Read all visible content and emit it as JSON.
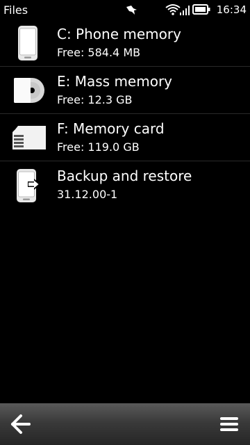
{
  "status_bar": {
    "app_title": "Files",
    "clock": "16:34",
    "icons": [
      "notification-bird-icon",
      "wifi-icon",
      "signal-strength-icon",
      "battery-icon"
    ]
  },
  "storage_list": [
    {
      "title": "C: Phone memory",
      "subtitle": "Free: 584.4 MB",
      "icon": "phone-memory-icon"
    },
    {
      "title": "E: Mass memory",
      "subtitle": "Free: 12.3 GB",
      "icon": "mass-memory-disc-icon"
    },
    {
      "title": "F: Memory card",
      "subtitle": "Free: 119.0 GB",
      "icon": "memory-card-icon"
    },
    {
      "title": "Backup and restore",
      "subtitle": "31.12.00-1",
      "icon": "backup-restore-icon"
    }
  ],
  "toolbar": {
    "back_icon": "back-arrow-icon",
    "menu_icon": "menu-icon"
  },
  "colors": {
    "background": "#000000",
    "text": "#ffffff",
    "toolbar": "#3a3a3a"
  }
}
